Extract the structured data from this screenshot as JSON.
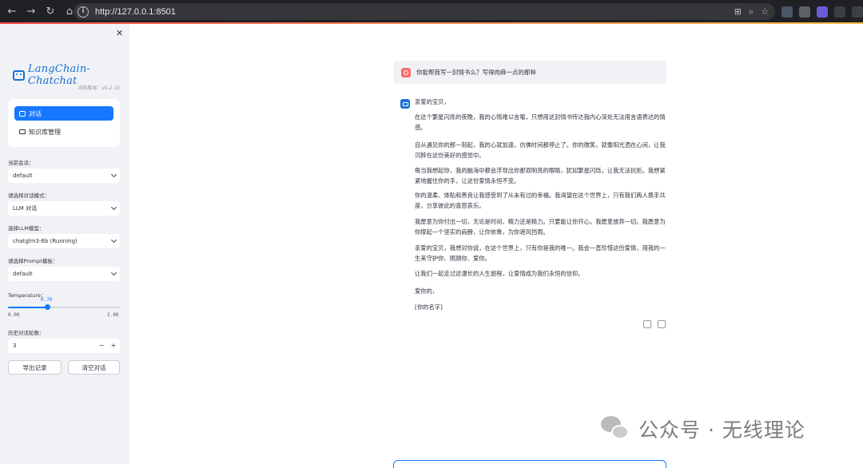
{
  "browser": {
    "url": "http://127.0.0.1:8501"
  },
  "sidebar": {
    "logo_text": "LangChain-Chatchat",
    "version": "当前版本：v0.2.10",
    "menu": [
      {
        "label": "对话"
      },
      {
        "label": "知识库管理"
      }
    ],
    "current_session_label": "当前会话：",
    "current_session_value": "default",
    "dialog_mode_label": "请选择对话模式：",
    "dialog_mode_value": "LLM 对话",
    "llm_model_label": "选择LLM模型：",
    "llm_model_value": "chatglm3-6b (Running)",
    "prompt_template_label": "请选择Prompt模板：",
    "prompt_template_value": "default",
    "temperature_label": "Temperature：",
    "temperature_value": "0.70",
    "temperature_min": "0.00",
    "temperature_max": "2.00",
    "temperature_fraction": 0.35,
    "history_rounds_label": "历史对话轮数：",
    "history_rounds_value": "3",
    "stepper_minus": "−",
    "stepper_plus": "+",
    "export_button": "导出记录",
    "clear_button": "清空对话"
  },
  "chat": {
    "user_message": "你能帮我写一封情书么？写得肉麻一点的那种",
    "bot_paragraphs": [
      "亲爱的宝贝，",
      "在这个繁星闪烁的夜晚，我的心情难以言喻，只想用这封情书传达我内心深处无法用言语表达的情感。",
      "自从遇见你的那一刻起，我的心就加速，仿佛时间都停止了。你的微笑，就像阳光洒在心间，让我沉醉在这份美好的感觉中。",
      "每当我想起你，我的脑海中都会浮现出你那双明亮的眼睛，犹如繁星闪烁，让我无法抗拒。我想紧紧地握住你的手，让这份爱情永恒不变。",
      "你的温柔、体贴和善良让我感受到了从未有过的幸福。我渴望在这个世界上，只有我们两人携手共度，分享彼此的喜怒哀乐。",
      "我愿意为你付出一切，无论是时间、精力还是精力。只要能让你开心，我愿意放弃一切。我愿意为你撑起一个坚实的肩膀，让你依靠，为你遮风挡雨。",
      "亲爱的宝贝，我想对你说，在这个世界上，只有你是我的唯一。我会一直珍惜这份爱情，用我的一生来守护你、照顾你、爱你。",
      "让我们一起走过这漫长的人生旅程，让爱情成为我们永恒的信仰。",
      "爱你的，",
      "[你的名字]"
    ]
  },
  "watermark": {
    "text": "公众号 · 无线理论"
  },
  "colors": {
    "accent": "#1677ff",
    "brand": "#1a6fd6",
    "sidebar_bg": "#f0f2f6",
    "user_avatar": "#ff6b6b"
  }
}
